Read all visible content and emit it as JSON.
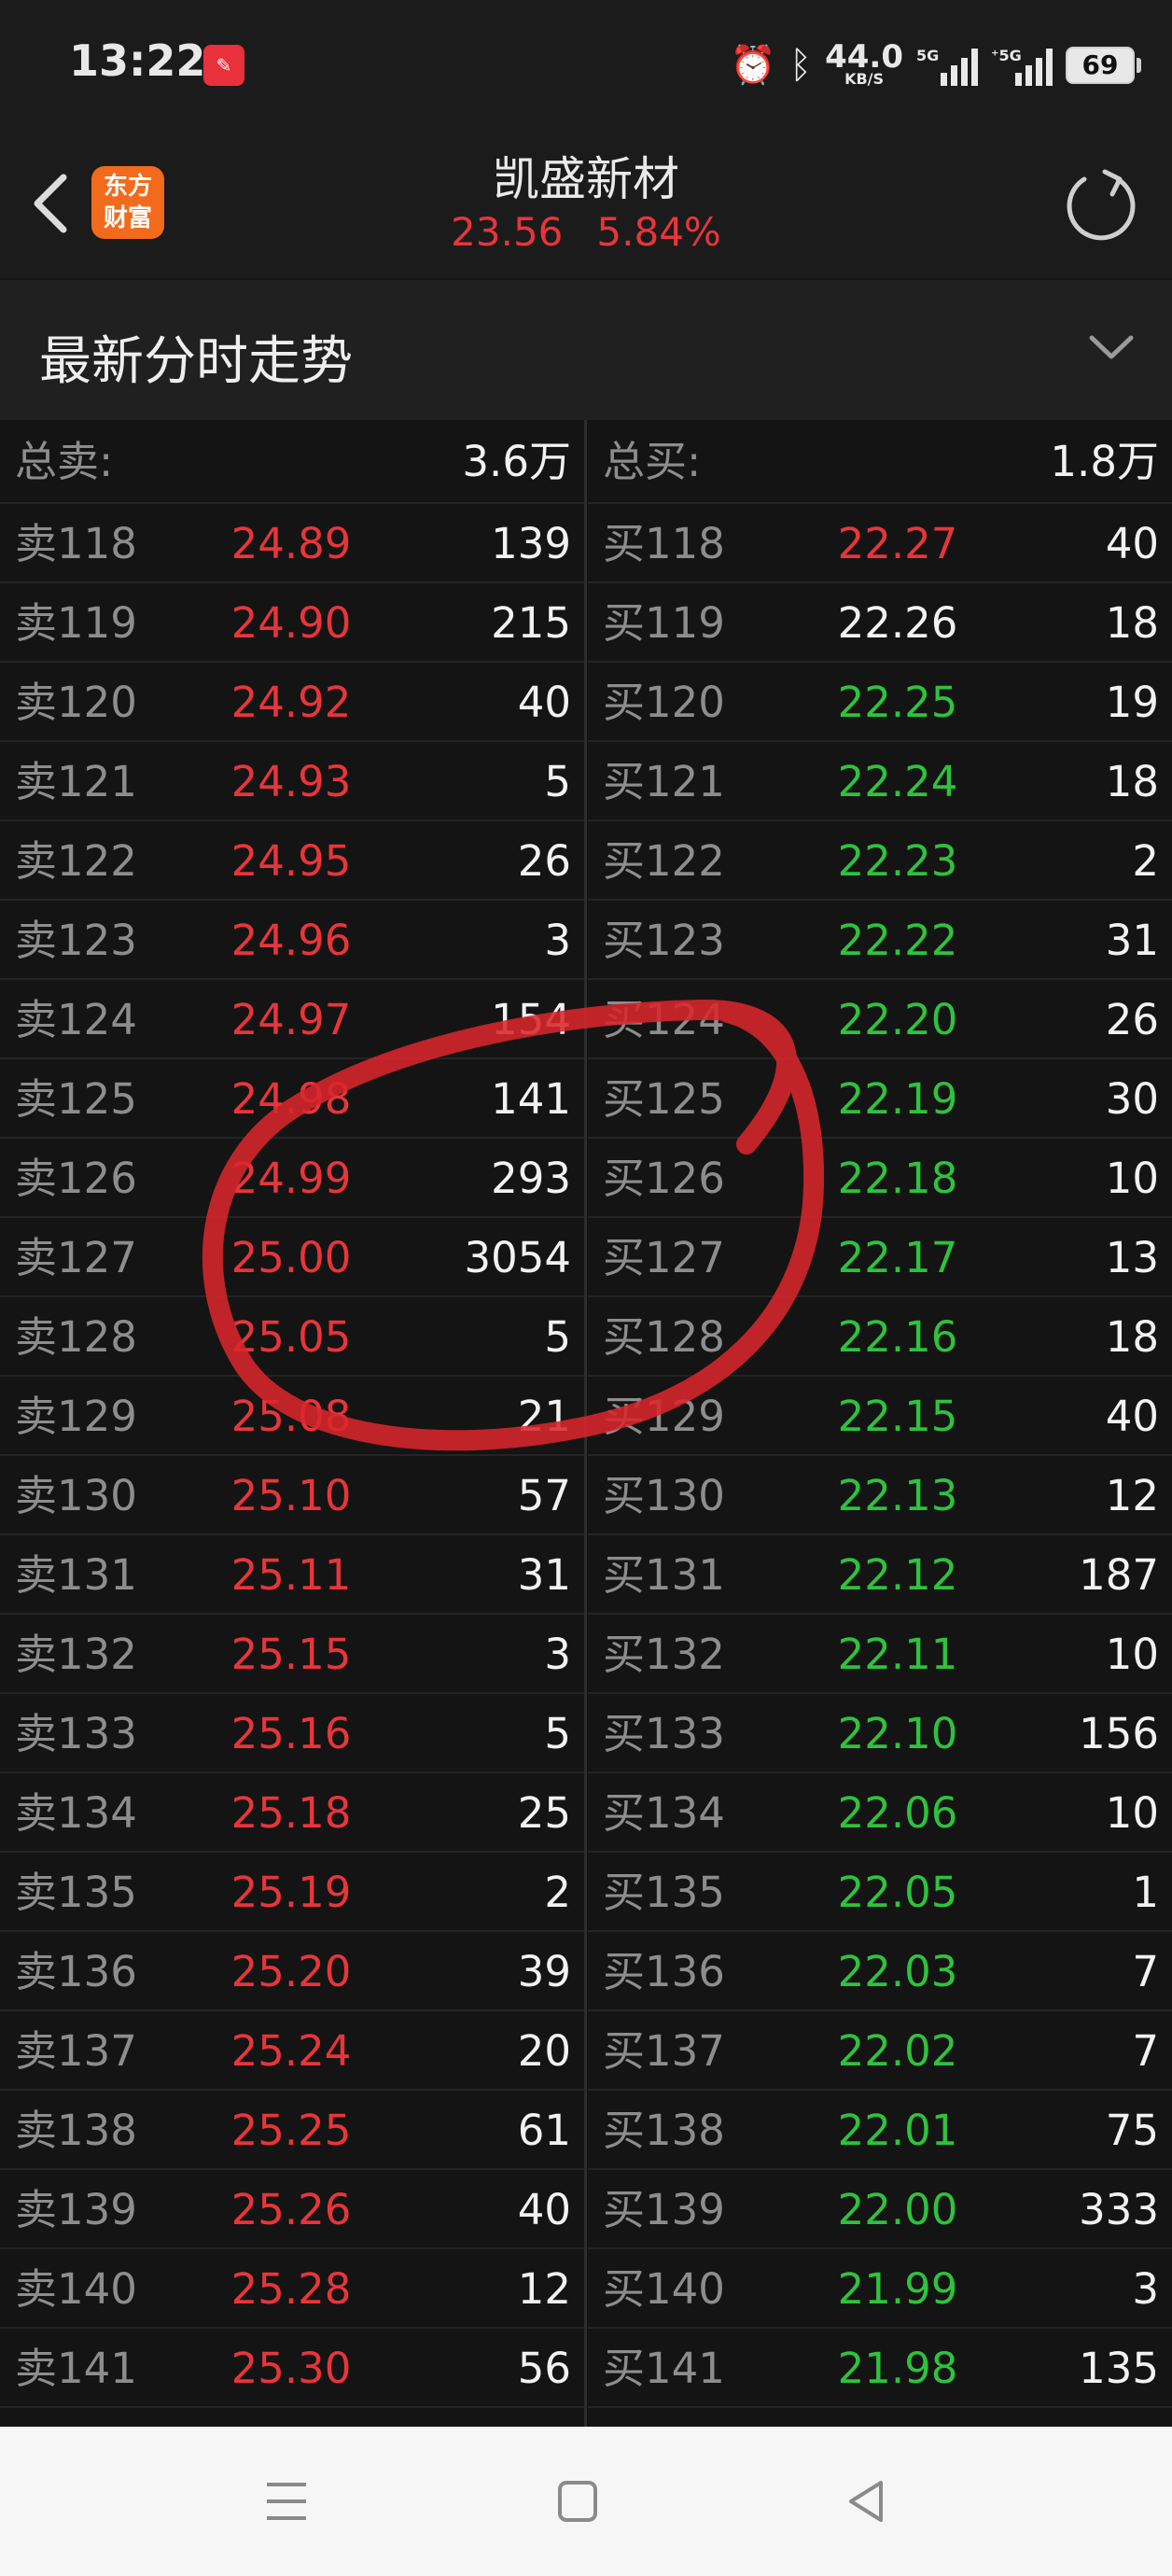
{
  "status": {
    "time": "13:22",
    "app_badge": "✎",
    "net_speed": "44.0",
    "net_unit": "KB/S",
    "sim1": "5G",
    "sim2": "⁺5G",
    "battery": "69"
  },
  "header": {
    "logo_line1": "东方",
    "logo_line2": "财富",
    "stock_name": "凯盛新材",
    "price": "23.56",
    "change_pct": "5.84%"
  },
  "section": {
    "title": "最新分时走势"
  },
  "order_book": {
    "sell_total_label": "总卖:",
    "sell_total_value": "3.6万",
    "buy_total_label": "总买:",
    "buy_total_value": "1.8万",
    "colors": {
      "up": "#e8353a",
      "down": "#2ec23d",
      "flat": "#f2f2f2"
    },
    "sell_rows": [
      {
        "label": "卖118",
        "price": "24.89",
        "volume": "139"
      },
      {
        "label": "卖119",
        "price": "24.90",
        "volume": "215"
      },
      {
        "label": "卖120",
        "price": "24.92",
        "volume": "40"
      },
      {
        "label": "卖121",
        "price": "24.93",
        "volume": "5"
      },
      {
        "label": "卖122",
        "price": "24.95",
        "volume": "26"
      },
      {
        "label": "卖123",
        "price": "24.96",
        "volume": "3"
      },
      {
        "label": "卖124",
        "price": "24.97",
        "volume": "154"
      },
      {
        "label": "卖125",
        "price": "24.98",
        "volume": "141"
      },
      {
        "label": "卖126",
        "price": "24.99",
        "volume": "293"
      },
      {
        "label": "卖127",
        "price": "25.00",
        "volume": "3054"
      },
      {
        "label": "卖128",
        "price": "25.05",
        "volume": "5"
      },
      {
        "label": "卖129",
        "price": "25.08",
        "volume": "21"
      },
      {
        "label": "卖130",
        "price": "25.10",
        "volume": "57"
      },
      {
        "label": "卖131",
        "price": "25.11",
        "volume": "31"
      },
      {
        "label": "卖132",
        "price": "25.15",
        "volume": "3"
      },
      {
        "label": "卖133",
        "price": "25.16",
        "volume": "5"
      },
      {
        "label": "卖134",
        "price": "25.18",
        "volume": "25"
      },
      {
        "label": "卖135",
        "price": "25.19",
        "volume": "2"
      },
      {
        "label": "卖136",
        "price": "25.20",
        "volume": "39"
      },
      {
        "label": "卖137",
        "price": "25.24",
        "volume": "20"
      },
      {
        "label": "卖138",
        "price": "25.25",
        "volume": "61"
      },
      {
        "label": "卖139",
        "price": "25.26",
        "volume": "40"
      },
      {
        "label": "卖140",
        "price": "25.28",
        "volume": "12"
      },
      {
        "label": "卖141",
        "price": "25.30",
        "volume": "56"
      }
    ],
    "buy_rows": [
      {
        "label": "买118",
        "price": "22.27",
        "volume": "40",
        "tone": "up"
      },
      {
        "label": "买119",
        "price": "22.26",
        "volume": "18",
        "tone": "flat"
      },
      {
        "label": "买120",
        "price": "22.25",
        "volume": "19",
        "tone": "down"
      },
      {
        "label": "买121",
        "price": "22.24",
        "volume": "18",
        "tone": "down"
      },
      {
        "label": "买122",
        "price": "22.23",
        "volume": "2",
        "tone": "down"
      },
      {
        "label": "买123",
        "price": "22.22",
        "volume": "31",
        "tone": "down"
      },
      {
        "label": "买124",
        "price": "22.20",
        "volume": "26",
        "tone": "down"
      },
      {
        "label": "买125",
        "price": "22.19",
        "volume": "30",
        "tone": "down"
      },
      {
        "label": "买126",
        "price": "22.18",
        "volume": "10",
        "tone": "down"
      },
      {
        "label": "买127",
        "price": "22.17",
        "volume": "13",
        "tone": "down"
      },
      {
        "label": "买128",
        "price": "22.16",
        "volume": "18",
        "tone": "down"
      },
      {
        "label": "买129",
        "price": "22.15",
        "volume": "40",
        "tone": "down"
      },
      {
        "label": "买130",
        "price": "22.13",
        "volume": "12",
        "tone": "down"
      },
      {
        "label": "买131",
        "price": "22.12",
        "volume": "187",
        "tone": "down"
      },
      {
        "label": "买132",
        "price": "22.11",
        "volume": "10",
        "tone": "down"
      },
      {
        "label": "买133",
        "price": "22.10",
        "volume": "156",
        "tone": "down"
      },
      {
        "label": "买134",
        "price": "22.06",
        "volume": "10",
        "tone": "down"
      },
      {
        "label": "买135",
        "price": "22.05",
        "volume": "1",
        "tone": "down"
      },
      {
        "label": "买136",
        "price": "22.03",
        "volume": "7",
        "tone": "down"
      },
      {
        "label": "买137",
        "price": "22.02",
        "volume": "7",
        "tone": "down"
      },
      {
        "label": "买138",
        "price": "22.01",
        "volume": "75",
        "tone": "down"
      },
      {
        "label": "买139",
        "price": "22.00",
        "volume": "333",
        "tone": "down"
      },
      {
        "label": "买140",
        "price": "21.99",
        "volume": "3",
        "tone": "down"
      },
      {
        "label": "买141",
        "price": "21.98",
        "volume": "135",
        "tone": "down"
      }
    ]
  },
  "annotation": {
    "color": "#d8262b"
  },
  "icons": {
    "back": "back-arrow-icon",
    "refresh": "refresh-icon",
    "collapse": "chevron-down-icon",
    "nav_menu": "menu-icon",
    "nav_home": "home-square-icon",
    "nav_back": "back-triangle-icon"
  }
}
